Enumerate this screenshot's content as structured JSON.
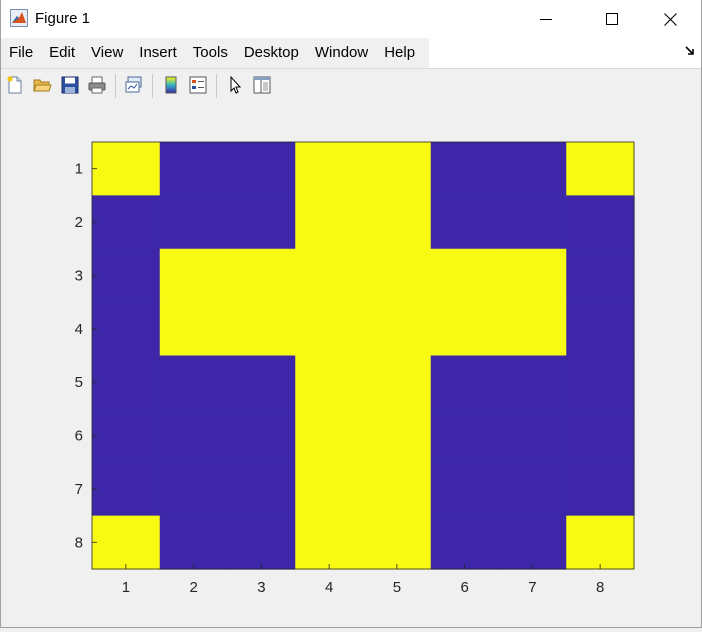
{
  "window": {
    "title": "Figure 1"
  },
  "menu": {
    "items": [
      "File",
      "Edit",
      "View",
      "Insert",
      "Tools",
      "Desktop",
      "Window",
      "Help"
    ]
  },
  "toolbar": {
    "icons": [
      "new-figure-icon",
      "open-file-icon",
      "save-icon",
      "print-icon",
      "link-plot-icon",
      "colorbar-icon",
      "legend-icon",
      "pointer-icon",
      "property-editor-icon"
    ]
  },
  "colors": {
    "low": "#3d26a8",
    "high": "#f9fa14",
    "axes_bg": "#ffffff"
  },
  "chart_data": {
    "type": "heatmap",
    "x_ticks": [
      "1",
      "2",
      "3",
      "4",
      "5",
      "6",
      "7",
      "8"
    ],
    "y_ticks": [
      "1",
      "2",
      "3",
      "4",
      "5",
      "6",
      "7",
      "8"
    ],
    "matrix": [
      [
        1,
        0,
        0,
        1,
        1,
        0,
        0,
        1
      ],
      [
        0,
        0,
        0,
        1,
        1,
        0,
        0,
        0
      ],
      [
        0,
        1,
        1,
        1,
        1,
        1,
        1,
        0
      ],
      [
        0,
        1,
        1,
        1,
        1,
        1,
        1,
        0
      ],
      [
        0,
        0,
        0,
        1,
        1,
        0,
        0,
        0
      ],
      [
        0,
        0,
        0,
        1,
        1,
        0,
        0,
        0
      ],
      [
        0,
        0,
        0,
        1,
        1,
        0,
        0,
        0
      ],
      [
        1,
        0,
        0,
        1,
        1,
        0,
        0,
        1
      ]
    ]
  }
}
